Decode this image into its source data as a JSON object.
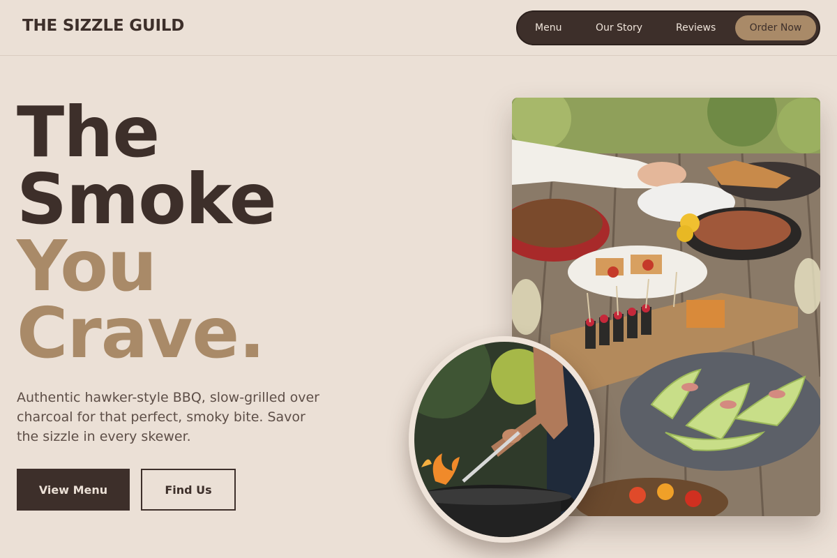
{
  "brand": {
    "name": "THE SIZZLE GUILD"
  },
  "nav": {
    "items": [
      "Menu",
      "Our Story",
      "Reviews"
    ],
    "cta": "Order Now"
  },
  "hero": {
    "headline": {
      "line1": "The",
      "line2": "Smoke",
      "line3": "You",
      "line4": "Crave."
    },
    "subtitle": "Authentic hawker-style BBQ, slow-grilled over charcoal for that perfect, smoky bite. Savor the sizzle in every skewer.",
    "primary_button": "View Menu",
    "secondary_button": "Find Us"
  },
  "images": {
    "feast_alt": "outdoor table with skewers, melon and grilled dishes",
    "grill_alt": "person grilling over flames"
  },
  "colors": {
    "background": "#ebe0d6",
    "dark": "#3d2f2a",
    "accent": "#a98a68",
    "muted_text": "#5d4e47"
  }
}
